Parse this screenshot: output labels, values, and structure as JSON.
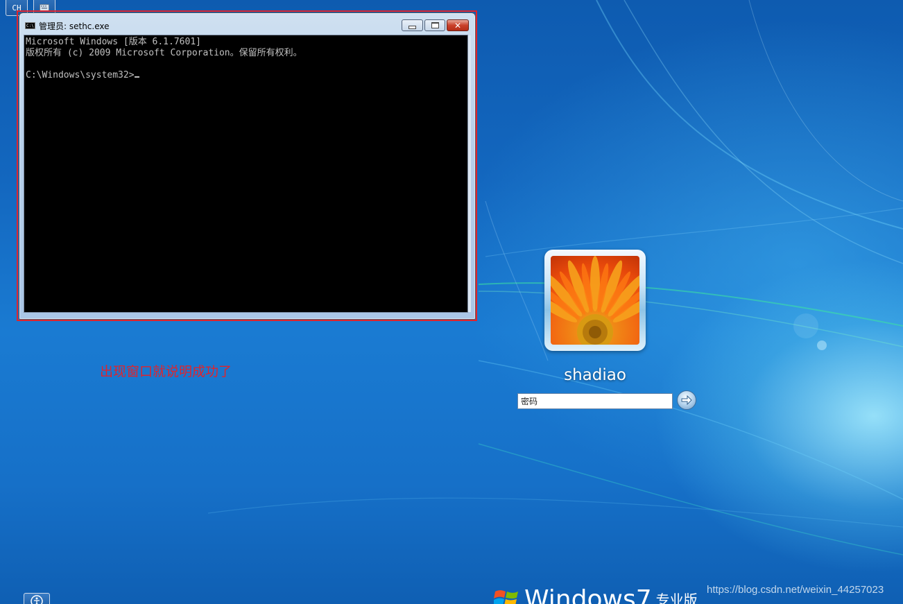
{
  "top_indicators": {
    "language_label": "CH"
  },
  "console_window": {
    "title": "管理员: sethc.exe",
    "icon_label": "C:\\",
    "lines": [
      "Microsoft Windows [版本 6.1.7601]",
      "版权所有 (c) 2009 Microsoft Corporation。保留所有权利。",
      "C:\\Windows\\system32>"
    ]
  },
  "annotation": {
    "text": "出现窗口就说明成功了",
    "color": "#e0242c"
  },
  "login": {
    "username": "shadiao",
    "password_placeholder": "密码"
  },
  "branding": {
    "windows_text": "Windows",
    "version_mark": "7",
    "edition": "专业版"
  },
  "watermark": {
    "text": "https://blog.csdn.net/weixin_44257023"
  }
}
